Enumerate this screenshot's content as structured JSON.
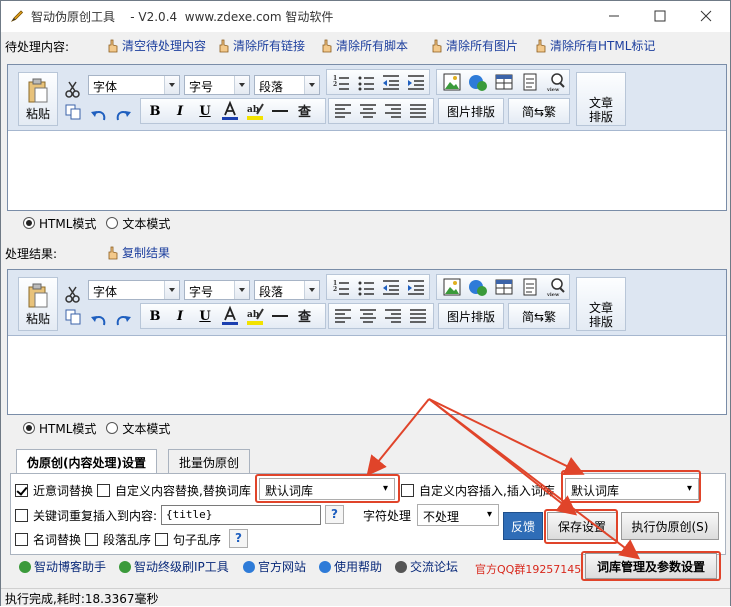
{
  "window": {
    "title": "智动伪原创工具    - V2.0.4  www.zdexe.com 智动软件",
    "colors": {
      "accent": "#2f6db7",
      "highlight": "#e0442a",
      "link": "#1d3f9e",
      "qq": "#d8281c"
    }
  },
  "input_section": {
    "label": "待处理内容:",
    "actions": [
      "清空待处理内容",
      "清除所有链接",
      "清除所有脚本",
      "清除所有图片",
      "清除所有HTML标记"
    ]
  },
  "editor": {
    "paste_label": "粘贴",
    "font_combo": "字体",
    "size_combo": "字号",
    "para_combo": "段落",
    "image_layout": "图片排版",
    "convert": "简⇆繁",
    "article_layout_1": "文章",
    "article_layout_2": "排版",
    "icons": [
      "cut-icon",
      "copy-icon",
      "undo-icon",
      "redo-icon",
      "bold-icon",
      "italic-icon",
      "underline-icon",
      "font-color-icon",
      "highlight-icon",
      "hr-icon",
      "find-icon",
      "align-left-icon",
      "align-center-icon",
      "align-right-icon",
      "justify-icon",
      "ordered-list-icon",
      "unordered-list-icon",
      "outdent-icon",
      "indent-icon",
      "image-icon",
      "emoji-icon",
      "table-icon",
      "note-icon",
      "view-icon"
    ]
  },
  "modes": {
    "html": "HTML模式",
    "text": "文本模式",
    "selected": "HTML模式"
  },
  "result_section": {
    "label": "处理结果:",
    "copy_action": "复制结果"
  },
  "tabs": [
    "伪原创(内容处理)设置",
    "批量伪原创"
  ],
  "settings": {
    "near_synonym": "近意词替换",
    "custom_replace": "自定义内容替换,替换词库",
    "replace_lib": "默认词库",
    "custom_insert": "自定义内容插入,插入词库",
    "insert_lib": "默认词库",
    "keyword_insert": "关键词重复插入到内容:",
    "keyword_value": "{title}",
    "char_process": "字符处理",
    "char_option": "不处理",
    "noun_replace": "名词替换",
    "para_shuffle": "段落乱序",
    "sentence_shuffle": "句子乱序",
    "help": "?"
  },
  "buttons": {
    "feedback": "反馈",
    "save": "保存设置",
    "execute": "执行伪原创(S)",
    "library": "词库管理及参数设置"
  },
  "footer_links": [
    "智动博客助手",
    "智动终级刷IP工具",
    "官方网站",
    "使用帮助",
    "交流论坛"
  ],
  "qq_group": "官方QQ群19257145",
  "status": "执行完成,耗时:18.3367毫秒"
}
